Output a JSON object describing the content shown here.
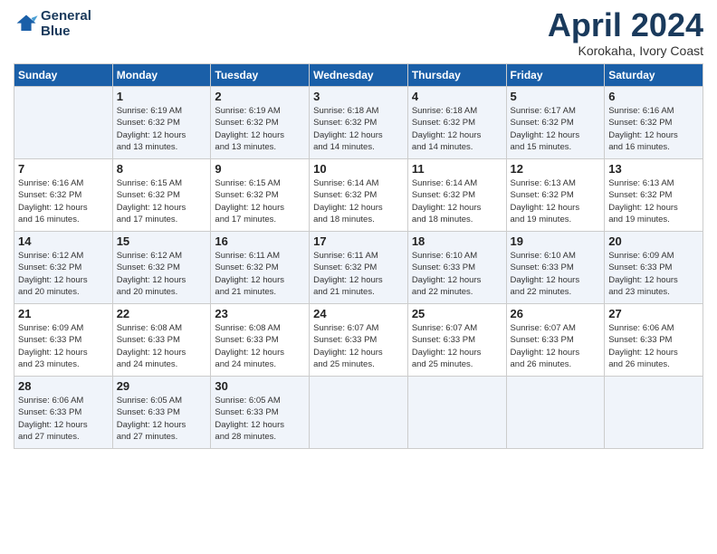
{
  "header": {
    "logo_line1": "General",
    "logo_line2": "Blue",
    "month_title": "April 2024",
    "location": "Korokaha, Ivory Coast"
  },
  "weekdays": [
    "Sunday",
    "Monday",
    "Tuesday",
    "Wednesday",
    "Thursday",
    "Friday",
    "Saturday"
  ],
  "weeks": [
    [
      {
        "day": "",
        "info": ""
      },
      {
        "day": "1",
        "info": "Sunrise: 6:19 AM\nSunset: 6:32 PM\nDaylight: 12 hours\nand 13 minutes."
      },
      {
        "day": "2",
        "info": "Sunrise: 6:19 AM\nSunset: 6:32 PM\nDaylight: 12 hours\nand 13 minutes."
      },
      {
        "day": "3",
        "info": "Sunrise: 6:18 AM\nSunset: 6:32 PM\nDaylight: 12 hours\nand 14 minutes."
      },
      {
        "day": "4",
        "info": "Sunrise: 6:18 AM\nSunset: 6:32 PM\nDaylight: 12 hours\nand 14 minutes."
      },
      {
        "day": "5",
        "info": "Sunrise: 6:17 AM\nSunset: 6:32 PM\nDaylight: 12 hours\nand 15 minutes."
      },
      {
        "day": "6",
        "info": "Sunrise: 6:16 AM\nSunset: 6:32 PM\nDaylight: 12 hours\nand 16 minutes."
      }
    ],
    [
      {
        "day": "7",
        "info": "Sunrise: 6:16 AM\nSunset: 6:32 PM\nDaylight: 12 hours\nand 16 minutes."
      },
      {
        "day": "8",
        "info": "Sunrise: 6:15 AM\nSunset: 6:32 PM\nDaylight: 12 hours\nand 17 minutes."
      },
      {
        "day": "9",
        "info": "Sunrise: 6:15 AM\nSunset: 6:32 PM\nDaylight: 12 hours\nand 17 minutes."
      },
      {
        "day": "10",
        "info": "Sunrise: 6:14 AM\nSunset: 6:32 PM\nDaylight: 12 hours\nand 18 minutes."
      },
      {
        "day": "11",
        "info": "Sunrise: 6:14 AM\nSunset: 6:32 PM\nDaylight: 12 hours\nand 18 minutes."
      },
      {
        "day": "12",
        "info": "Sunrise: 6:13 AM\nSunset: 6:32 PM\nDaylight: 12 hours\nand 19 minutes."
      },
      {
        "day": "13",
        "info": "Sunrise: 6:13 AM\nSunset: 6:32 PM\nDaylight: 12 hours\nand 19 minutes."
      }
    ],
    [
      {
        "day": "14",
        "info": "Sunrise: 6:12 AM\nSunset: 6:32 PM\nDaylight: 12 hours\nand 20 minutes."
      },
      {
        "day": "15",
        "info": "Sunrise: 6:12 AM\nSunset: 6:32 PM\nDaylight: 12 hours\nand 20 minutes."
      },
      {
        "day": "16",
        "info": "Sunrise: 6:11 AM\nSunset: 6:32 PM\nDaylight: 12 hours\nand 21 minutes."
      },
      {
        "day": "17",
        "info": "Sunrise: 6:11 AM\nSunset: 6:32 PM\nDaylight: 12 hours\nand 21 minutes."
      },
      {
        "day": "18",
        "info": "Sunrise: 6:10 AM\nSunset: 6:33 PM\nDaylight: 12 hours\nand 22 minutes."
      },
      {
        "day": "19",
        "info": "Sunrise: 6:10 AM\nSunset: 6:33 PM\nDaylight: 12 hours\nand 22 minutes."
      },
      {
        "day": "20",
        "info": "Sunrise: 6:09 AM\nSunset: 6:33 PM\nDaylight: 12 hours\nand 23 minutes."
      }
    ],
    [
      {
        "day": "21",
        "info": "Sunrise: 6:09 AM\nSunset: 6:33 PM\nDaylight: 12 hours\nand 23 minutes."
      },
      {
        "day": "22",
        "info": "Sunrise: 6:08 AM\nSunset: 6:33 PM\nDaylight: 12 hours\nand 24 minutes."
      },
      {
        "day": "23",
        "info": "Sunrise: 6:08 AM\nSunset: 6:33 PM\nDaylight: 12 hours\nand 24 minutes."
      },
      {
        "day": "24",
        "info": "Sunrise: 6:07 AM\nSunset: 6:33 PM\nDaylight: 12 hours\nand 25 minutes."
      },
      {
        "day": "25",
        "info": "Sunrise: 6:07 AM\nSunset: 6:33 PM\nDaylight: 12 hours\nand 25 minutes."
      },
      {
        "day": "26",
        "info": "Sunrise: 6:07 AM\nSunset: 6:33 PM\nDaylight: 12 hours\nand 26 minutes."
      },
      {
        "day": "27",
        "info": "Sunrise: 6:06 AM\nSunset: 6:33 PM\nDaylight: 12 hours\nand 26 minutes."
      }
    ],
    [
      {
        "day": "28",
        "info": "Sunrise: 6:06 AM\nSunset: 6:33 PM\nDaylight: 12 hours\nand 27 minutes."
      },
      {
        "day": "29",
        "info": "Sunrise: 6:05 AM\nSunset: 6:33 PM\nDaylight: 12 hours\nand 27 minutes."
      },
      {
        "day": "30",
        "info": "Sunrise: 6:05 AM\nSunset: 6:33 PM\nDaylight: 12 hours\nand 28 minutes."
      },
      {
        "day": "",
        "info": ""
      },
      {
        "day": "",
        "info": ""
      },
      {
        "day": "",
        "info": ""
      },
      {
        "day": "",
        "info": ""
      }
    ]
  ]
}
